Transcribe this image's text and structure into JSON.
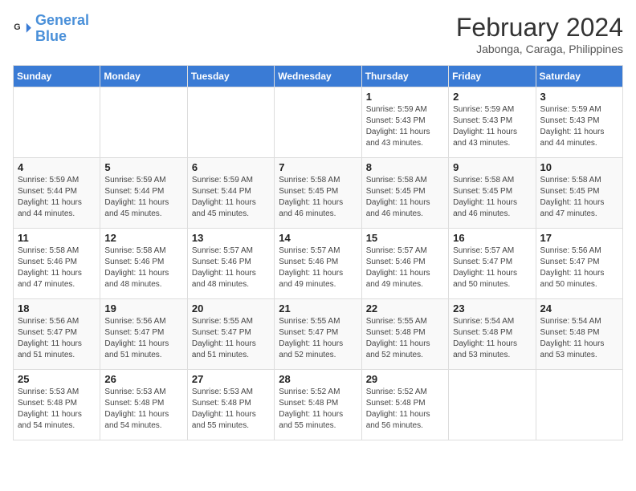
{
  "header": {
    "logo_general": "General",
    "logo_blue": "Blue",
    "month_year": "February 2024",
    "location": "Jabonga, Caraga, Philippines"
  },
  "weekdays": [
    "Sunday",
    "Monday",
    "Tuesday",
    "Wednesday",
    "Thursday",
    "Friday",
    "Saturday"
  ],
  "weeks": [
    [
      {
        "day": "",
        "info": ""
      },
      {
        "day": "",
        "info": ""
      },
      {
        "day": "",
        "info": ""
      },
      {
        "day": "",
        "info": ""
      },
      {
        "day": "1",
        "info": "Sunrise: 5:59 AM\nSunset: 5:43 PM\nDaylight: 11 hours\nand 43 minutes."
      },
      {
        "day": "2",
        "info": "Sunrise: 5:59 AM\nSunset: 5:43 PM\nDaylight: 11 hours\nand 43 minutes."
      },
      {
        "day": "3",
        "info": "Sunrise: 5:59 AM\nSunset: 5:43 PM\nDaylight: 11 hours\nand 44 minutes."
      }
    ],
    [
      {
        "day": "4",
        "info": "Sunrise: 5:59 AM\nSunset: 5:44 PM\nDaylight: 11 hours\nand 44 minutes."
      },
      {
        "day": "5",
        "info": "Sunrise: 5:59 AM\nSunset: 5:44 PM\nDaylight: 11 hours\nand 45 minutes."
      },
      {
        "day": "6",
        "info": "Sunrise: 5:59 AM\nSunset: 5:44 PM\nDaylight: 11 hours\nand 45 minutes."
      },
      {
        "day": "7",
        "info": "Sunrise: 5:58 AM\nSunset: 5:45 PM\nDaylight: 11 hours\nand 46 minutes."
      },
      {
        "day": "8",
        "info": "Sunrise: 5:58 AM\nSunset: 5:45 PM\nDaylight: 11 hours\nand 46 minutes."
      },
      {
        "day": "9",
        "info": "Sunrise: 5:58 AM\nSunset: 5:45 PM\nDaylight: 11 hours\nand 46 minutes."
      },
      {
        "day": "10",
        "info": "Sunrise: 5:58 AM\nSunset: 5:45 PM\nDaylight: 11 hours\nand 47 minutes."
      }
    ],
    [
      {
        "day": "11",
        "info": "Sunrise: 5:58 AM\nSunset: 5:46 PM\nDaylight: 11 hours\nand 47 minutes."
      },
      {
        "day": "12",
        "info": "Sunrise: 5:58 AM\nSunset: 5:46 PM\nDaylight: 11 hours\nand 48 minutes."
      },
      {
        "day": "13",
        "info": "Sunrise: 5:57 AM\nSunset: 5:46 PM\nDaylight: 11 hours\nand 48 minutes."
      },
      {
        "day": "14",
        "info": "Sunrise: 5:57 AM\nSunset: 5:46 PM\nDaylight: 11 hours\nand 49 minutes."
      },
      {
        "day": "15",
        "info": "Sunrise: 5:57 AM\nSunset: 5:46 PM\nDaylight: 11 hours\nand 49 minutes."
      },
      {
        "day": "16",
        "info": "Sunrise: 5:57 AM\nSunset: 5:47 PM\nDaylight: 11 hours\nand 50 minutes."
      },
      {
        "day": "17",
        "info": "Sunrise: 5:56 AM\nSunset: 5:47 PM\nDaylight: 11 hours\nand 50 minutes."
      }
    ],
    [
      {
        "day": "18",
        "info": "Sunrise: 5:56 AM\nSunset: 5:47 PM\nDaylight: 11 hours\nand 51 minutes."
      },
      {
        "day": "19",
        "info": "Sunrise: 5:56 AM\nSunset: 5:47 PM\nDaylight: 11 hours\nand 51 minutes."
      },
      {
        "day": "20",
        "info": "Sunrise: 5:55 AM\nSunset: 5:47 PM\nDaylight: 11 hours\nand 51 minutes."
      },
      {
        "day": "21",
        "info": "Sunrise: 5:55 AM\nSunset: 5:47 PM\nDaylight: 11 hours\nand 52 minutes."
      },
      {
        "day": "22",
        "info": "Sunrise: 5:55 AM\nSunset: 5:48 PM\nDaylight: 11 hours\nand 52 minutes."
      },
      {
        "day": "23",
        "info": "Sunrise: 5:54 AM\nSunset: 5:48 PM\nDaylight: 11 hours\nand 53 minutes."
      },
      {
        "day": "24",
        "info": "Sunrise: 5:54 AM\nSunset: 5:48 PM\nDaylight: 11 hours\nand 53 minutes."
      }
    ],
    [
      {
        "day": "25",
        "info": "Sunrise: 5:53 AM\nSunset: 5:48 PM\nDaylight: 11 hours\nand 54 minutes."
      },
      {
        "day": "26",
        "info": "Sunrise: 5:53 AM\nSunset: 5:48 PM\nDaylight: 11 hours\nand 54 minutes."
      },
      {
        "day": "27",
        "info": "Sunrise: 5:53 AM\nSunset: 5:48 PM\nDaylight: 11 hours\nand 55 minutes."
      },
      {
        "day": "28",
        "info": "Sunrise: 5:52 AM\nSunset: 5:48 PM\nDaylight: 11 hours\nand 55 minutes."
      },
      {
        "day": "29",
        "info": "Sunrise: 5:52 AM\nSunset: 5:48 PM\nDaylight: 11 hours\nand 56 minutes."
      },
      {
        "day": "",
        "info": ""
      },
      {
        "day": "",
        "info": ""
      }
    ]
  ]
}
